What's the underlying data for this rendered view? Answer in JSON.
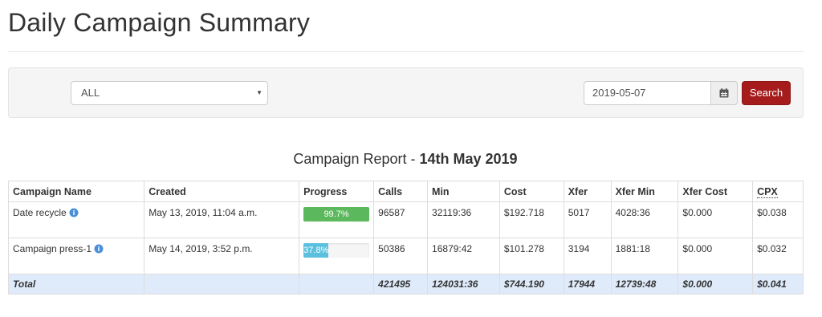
{
  "page": {
    "title": "Daily Campaign Summary"
  },
  "filters": {
    "campaign_select": {
      "value": "ALL"
    },
    "date_input": {
      "value": "2019-05-07"
    },
    "calendar_icon": "calendar-icon",
    "search_label": "Search"
  },
  "report": {
    "heading_prefix": "Campaign Report - ",
    "heading_date": "14th May 2019"
  },
  "table": {
    "headers": {
      "name": "Campaign Name",
      "created": "Created",
      "progress": "Progress",
      "calls": "Calls",
      "min": "Min",
      "cost": "Cost",
      "xfer": "Xfer",
      "xfer_min": "Xfer Min",
      "xfer_cost": "Xfer Cost",
      "cpx": "CPX"
    },
    "rows": [
      {
        "name": "Date recycle",
        "created": "May 13, 2019, 11:04 a.m.",
        "progress_label": "99.7%",
        "progress_value": 0.997,
        "calls": "96587",
        "min": "32119:36",
        "cost": "$192.718",
        "xfer": "5017",
        "xfer_min": "4028:36",
        "xfer_cost": "$0.000",
        "cpx": "$0.038"
      },
      {
        "name": "Campaign press-1",
        "created": "May 14, 2019, 3:52 p.m.",
        "progress_label": "37.8%",
        "progress_value": 0.378,
        "calls": "50386",
        "min": "16879:42",
        "cost": "$101.278",
        "xfer": "3194",
        "xfer_min": "1881:18",
        "xfer_cost": "$0.000",
        "cpx": "$0.032"
      }
    ],
    "total": {
      "label": "Total",
      "calls": "421495",
      "min": "124031:36",
      "cost": "$744.190",
      "xfer": "17944",
      "xfer_min": "12739:48",
      "xfer_cost": "$0.000",
      "cpx": "$0.041"
    }
  },
  "colors": {
    "search_button": "#a61c1c",
    "progress_success": "#5cb85c",
    "progress_info": "#5bc0de",
    "total_row": "#dfebfa"
  }
}
